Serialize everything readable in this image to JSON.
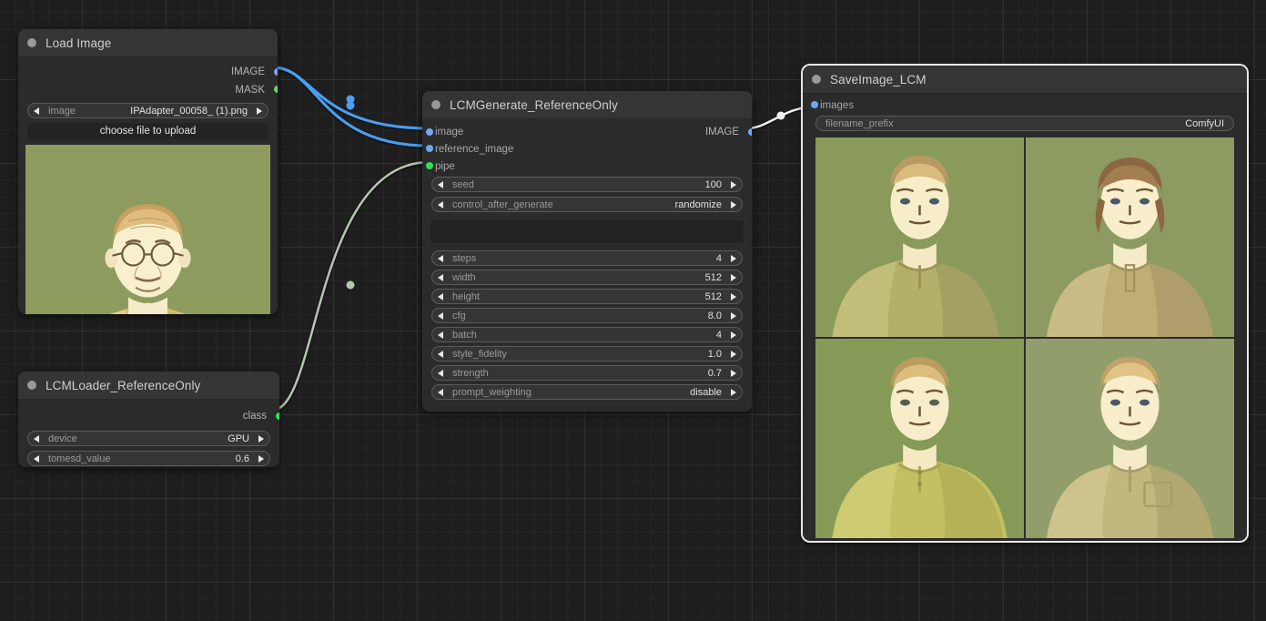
{
  "canvas": {
    "background": "#1e1e1e",
    "grid_minor": 18.4,
    "grid_major": 92
  },
  "colors": {
    "image_slot": "#6ca9f0",
    "mask_slot": "#5fd46a",
    "pipe_slot": "#2ee05a",
    "link_blue": "#4a9ef0",
    "link_green": "#b4c9b0",
    "link_white": "#f2f2f2",
    "node_body": "#2b2b2b",
    "node_title": "#353535",
    "selection": "#e8e8e8"
  },
  "nodes": {
    "load_image": {
      "title": "Load Image",
      "outputs": [
        {
          "label": "IMAGE",
          "color": "#6ca9f0"
        },
        {
          "label": "MASK",
          "color": "#5fd46a"
        }
      ],
      "widgets": [
        {
          "label": "image",
          "value": "IPAdapter_00058_ (1).png",
          "type": "combo"
        }
      ],
      "button": "choose file to upload",
      "preview": {
        "alt": "portrait of older man in olive shirt on green background"
      }
    },
    "lcm_loader": {
      "title": "LCMLoader_ReferenceOnly",
      "outputs": [
        {
          "label": "class",
          "color": "#2ee05a"
        }
      ],
      "widgets": [
        {
          "label": "device",
          "value": "GPU",
          "type": "combo"
        },
        {
          "label": "tomesd_value",
          "value": "0.6",
          "type": "number"
        }
      ]
    },
    "lcm_generate": {
      "title": "LCMGenerate_ReferenceOnly",
      "inputs": [
        {
          "label": "image",
          "color": "#6ca9f0"
        },
        {
          "label": "reference_image",
          "color": "#6ca9f0"
        },
        {
          "label": "pipe",
          "color": "#2ee05a"
        }
      ],
      "outputs": [
        {
          "label": "IMAGE",
          "color": "#6ca9f0"
        }
      ],
      "widgets_top": [
        {
          "label": "seed",
          "value": "100",
          "type": "number"
        },
        {
          "label": "control_after_generate",
          "value": "randomize",
          "type": "combo"
        }
      ],
      "text_widget": {
        "value": "",
        "placeholder": ""
      },
      "widgets_bottom": [
        {
          "label": "steps",
          "value": "4",
          "type": "number"
        },
        {
          "label": "width",
          "value": "512",
          "type": "number"
        },
        {
          "label": "height",
          "value": "512",
          "type": "number"
        },
        {
          "label": "cfg",
          "value": "8.0",
          "type": "number"
        },
        {
          "label": "batch",
          "value": "4",
          "type": "number"
        },
        {
          "label": "style_fidelity",
          "value": "1.0",
          "type": "number"
        },
        {
          "label": "strength",
          "value": "0.7",
          "type": "number"
        },
        {
          "label": "prompt_weighting",
          "value": "disable",
          "type": "combo"
        }
      ]
    },
    "save_image": {
      "title": "SaveImage_LCM",
      "selected": true,
      "inputs": [
        {
          "label": "images",
          "color": "#6ca9f0"
        }
      ],
      "widgets": [
        {
          "label": "filename_prefix",
          "value": "ComfyUI",
          "type": "text"
        }
      ],
      "results": [
        {
          "alt": "generated portrait variation 1 - blond man olive tee"
        },
        {
          "alt": "generated portrait variation 2 - brown haired man tan tee"
        },
        {
          "alt": "generated portrait variation 3 - man yellow henley shirt"
        },
        {
          "alt": "generated portrait variation 4 - man tan shirt with pocket"
        }
      ]
    }
  },
  "links": [
    {
      "from": "load_image.IMAGE",
      "to": "lcm_generate.image",
      "color": "#4a9ef0"
    },
    {
      "from": "load_image.IMAGE",
      "to": "lcm_generate.reference_image",
      "color": "#4a9ef0"
    },
    {
      "from": "lcm_loader.class",
      "to": "lcm_generate.pipe",
      "color": "#b4c9b0"
    },
    {
      "from": "lcm_generate.IMAGE",
      "to": "save_image.images",
      "color": "#f2f2f2"
    }
  ]
}
